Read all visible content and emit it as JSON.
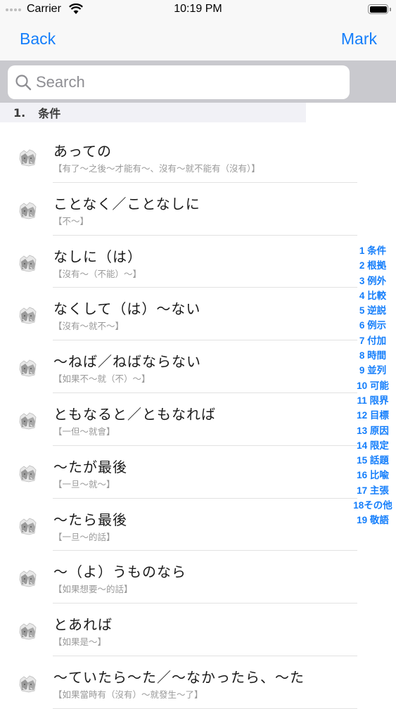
{
  "status_bar": {
    "carrier": "Carrier",
    "time": "10:19 PM"
  },
  "nav": {
    "back_label": "Back",
    "mark_label": "Mark"
  },
  "search": {
    "placeholder": "Search",
    "value": ""
  },
  "section": {
    "number": "1.",
    "title": "条件"
  },
  "items": [
    {
      "title": "あっての",
      "subtitle": "【有了～之後～才能有～、沒有～就不能有（沒有）】",
      "icon": "cat-illustration-icon"
    },
    {
      "title": "ことなく／ことなしに",
      "subtitle": "【不～】",
      "icon": "cat-illustration-icon"
    },
    {
      "title": "なしに（は）",
      "subtitle": "【沒有～（不能）～】",
      "icon": "cat-illustration-icon"
    },
    {
      "title": "なくして（は）～ない",
      "subtitle": "【沒有～就不～】",
      "icon": "cat-illustration-icon"
    },
    {
      "title": "～ねば／ねばならない",
      "subtitle": "【如果不～就（不）～】",
      "icon": "cat-illustration-icon"
    },
    {
      "title": "ともなると／ともなれば",
      "subtitle": "【一但～就會】",
      "icon": "cat-illustration-icon"
    },
    {
      "title": "～たが最後",
      "subtitle": "【一旦～就～】",
      "icon": "cat-illustration-icon"
    },
    {
      "title": "～たら最後",
      "subtitle": "【一旦～的話】",
      "icon": "cat-illustration-icon"
    },
    {
      "title": "～（よ）うものなら",
      "subtitle": "【如果想要～的話】",
      "icon": "cat-illustration-icon"
    },
    {
      "title": "とあれば",
      "subtitle": "【如果是～】",
      "icon": "cat-illustration-icon"
    },
    {
      "title": "～ていたら～た／～なかったら、～た",
      "subtitle": "【如果當時有（沒有）～就發生～了】",
      "icon": "cat-illustration-icon"
    }
  ],
  "index": [
    "1 条件",
    "2 根拠",
    "3 例外",
    "4 比較",
    "5 逆説",
    "6 例示",
    "7 付加",
    "8 時間",
    "9 並列",
    "10 可能",
    "11 限界",
    "12 目標",
    "13 原因",
    "14 限定",
    "15 話題",
    "16 比喩",
    "17 主張",
    "18その他",
    "19 敬語"
  ],
  "colors": {
    "accent": "#147efb",
    "search_bar_bg": "#c9c9ce",
    "section_header_bg": "#f1f1f6",
    "subtitle": "#9a9a9a"
  }
}
